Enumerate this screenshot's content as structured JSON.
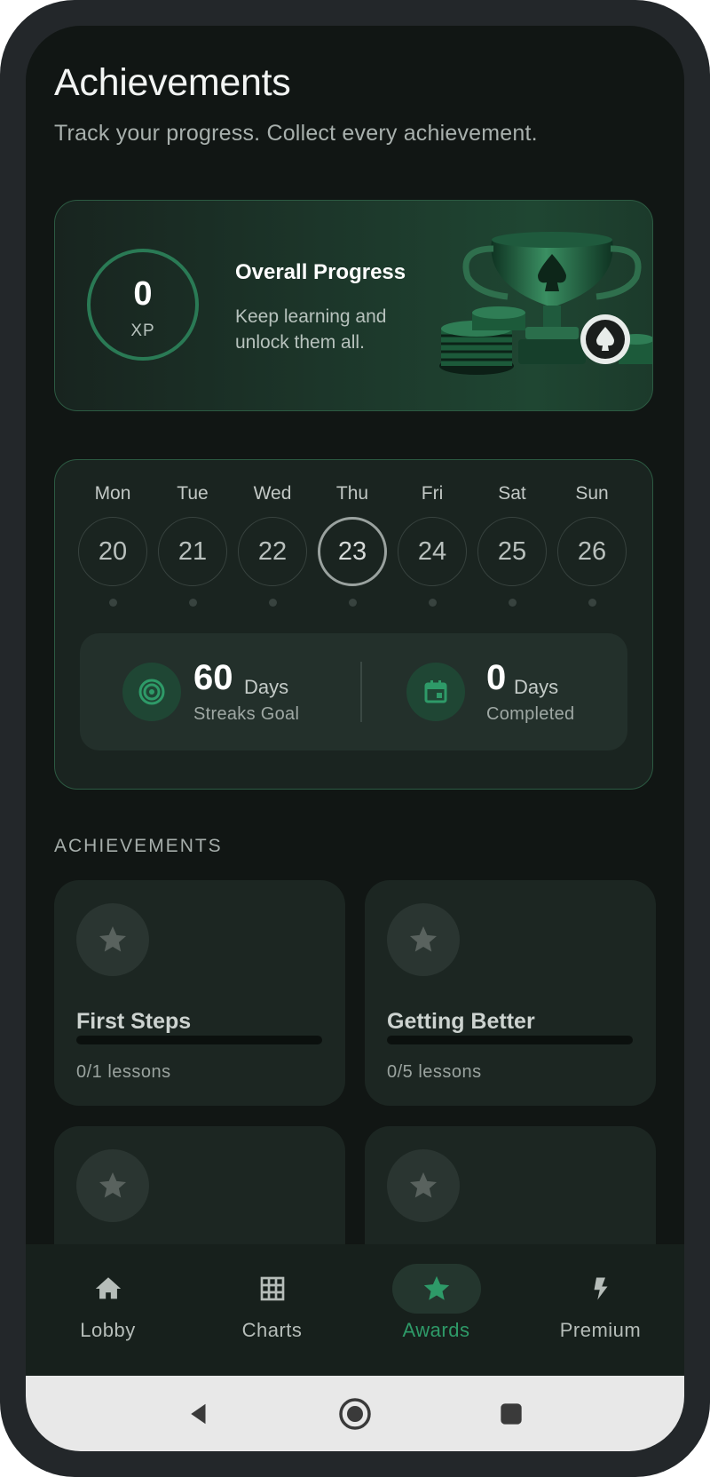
{
  "header": {
    "title": "Achievements",
    "subtitle": "Track your progress. Collect every achievement."
  },
  "progress_card": {
    "xp_value": "0",
    "xp_unit": "XP",
    "title": "Overall Progress",
    "description": "Keep learning and unlock them all.",
    "image": "trophy-with-poker-chips"
  },
  "week": {
    "days": [
      {
        "name": "Mon",
        "date": "20"
      },
      {
        "name": "Tue",
        "date": "21"
      },
      {
        "name": "Wed",
        "date": "22"
      },
      {
        "name": "Thu",
        "date": "23",
        "today": true
      },
      {
        "name": "Fri",
        "date": "24"
      },
      {
        "name": "Sat",
        "date": "25"
      },
      {
        "name": "Sun",
        "date": "26"
      }
    ]
  },
  "streaks": {
    "goal_value": "60",
    "goal_unit": "Days",
    "goal_label": "Streaks Goal",
    "goal_icon": "target-icon",
    "completed_value": "0",
    "completed_unit": "Days",
    "completed_label": "Completed",
    "completed_icon": "calendar-icon"
  },
  "achievements": {
    "heading": "ACHIEVEMENTS",
    "items": [
      {
        "title": "First Steps",
        "progress_text": "0/1 lessons",
        "progress": 0,
        "icon": "star-icon"
      },
      {
        "title": "Getting Better",
        "progress_text": "0/5 lessons",
        "progress": 0,
        "icon": "star-icon"
      },
      {
        "title": "",
        "progress_text": "",
        "progress": 0,
        "icon": "star-icon"
      },
      {
        "title": "",
        "progress_text": "",
        "progress": 0,
        "icon": "star-icon"
      }
    ]
  },
  "nav": {
    "items": [
      {
        "label": "Lobby",
        "icon": "home-icon"
      },
      {
        "label": "Charts",
        "icon": "grid-icon"
      },
      {
        "label": "Awards",
        "icon": "star-icon",
        "active": true
      },
      {
        "label": "Premium",
        "icon": "bolt-icon"
      }
    ]
  },
  "colors": {
    "accent": "#2e9a68",
    "background": "#111614",
    "card": "#1c2622",
    "border": "#2c5a42"
  }
}
